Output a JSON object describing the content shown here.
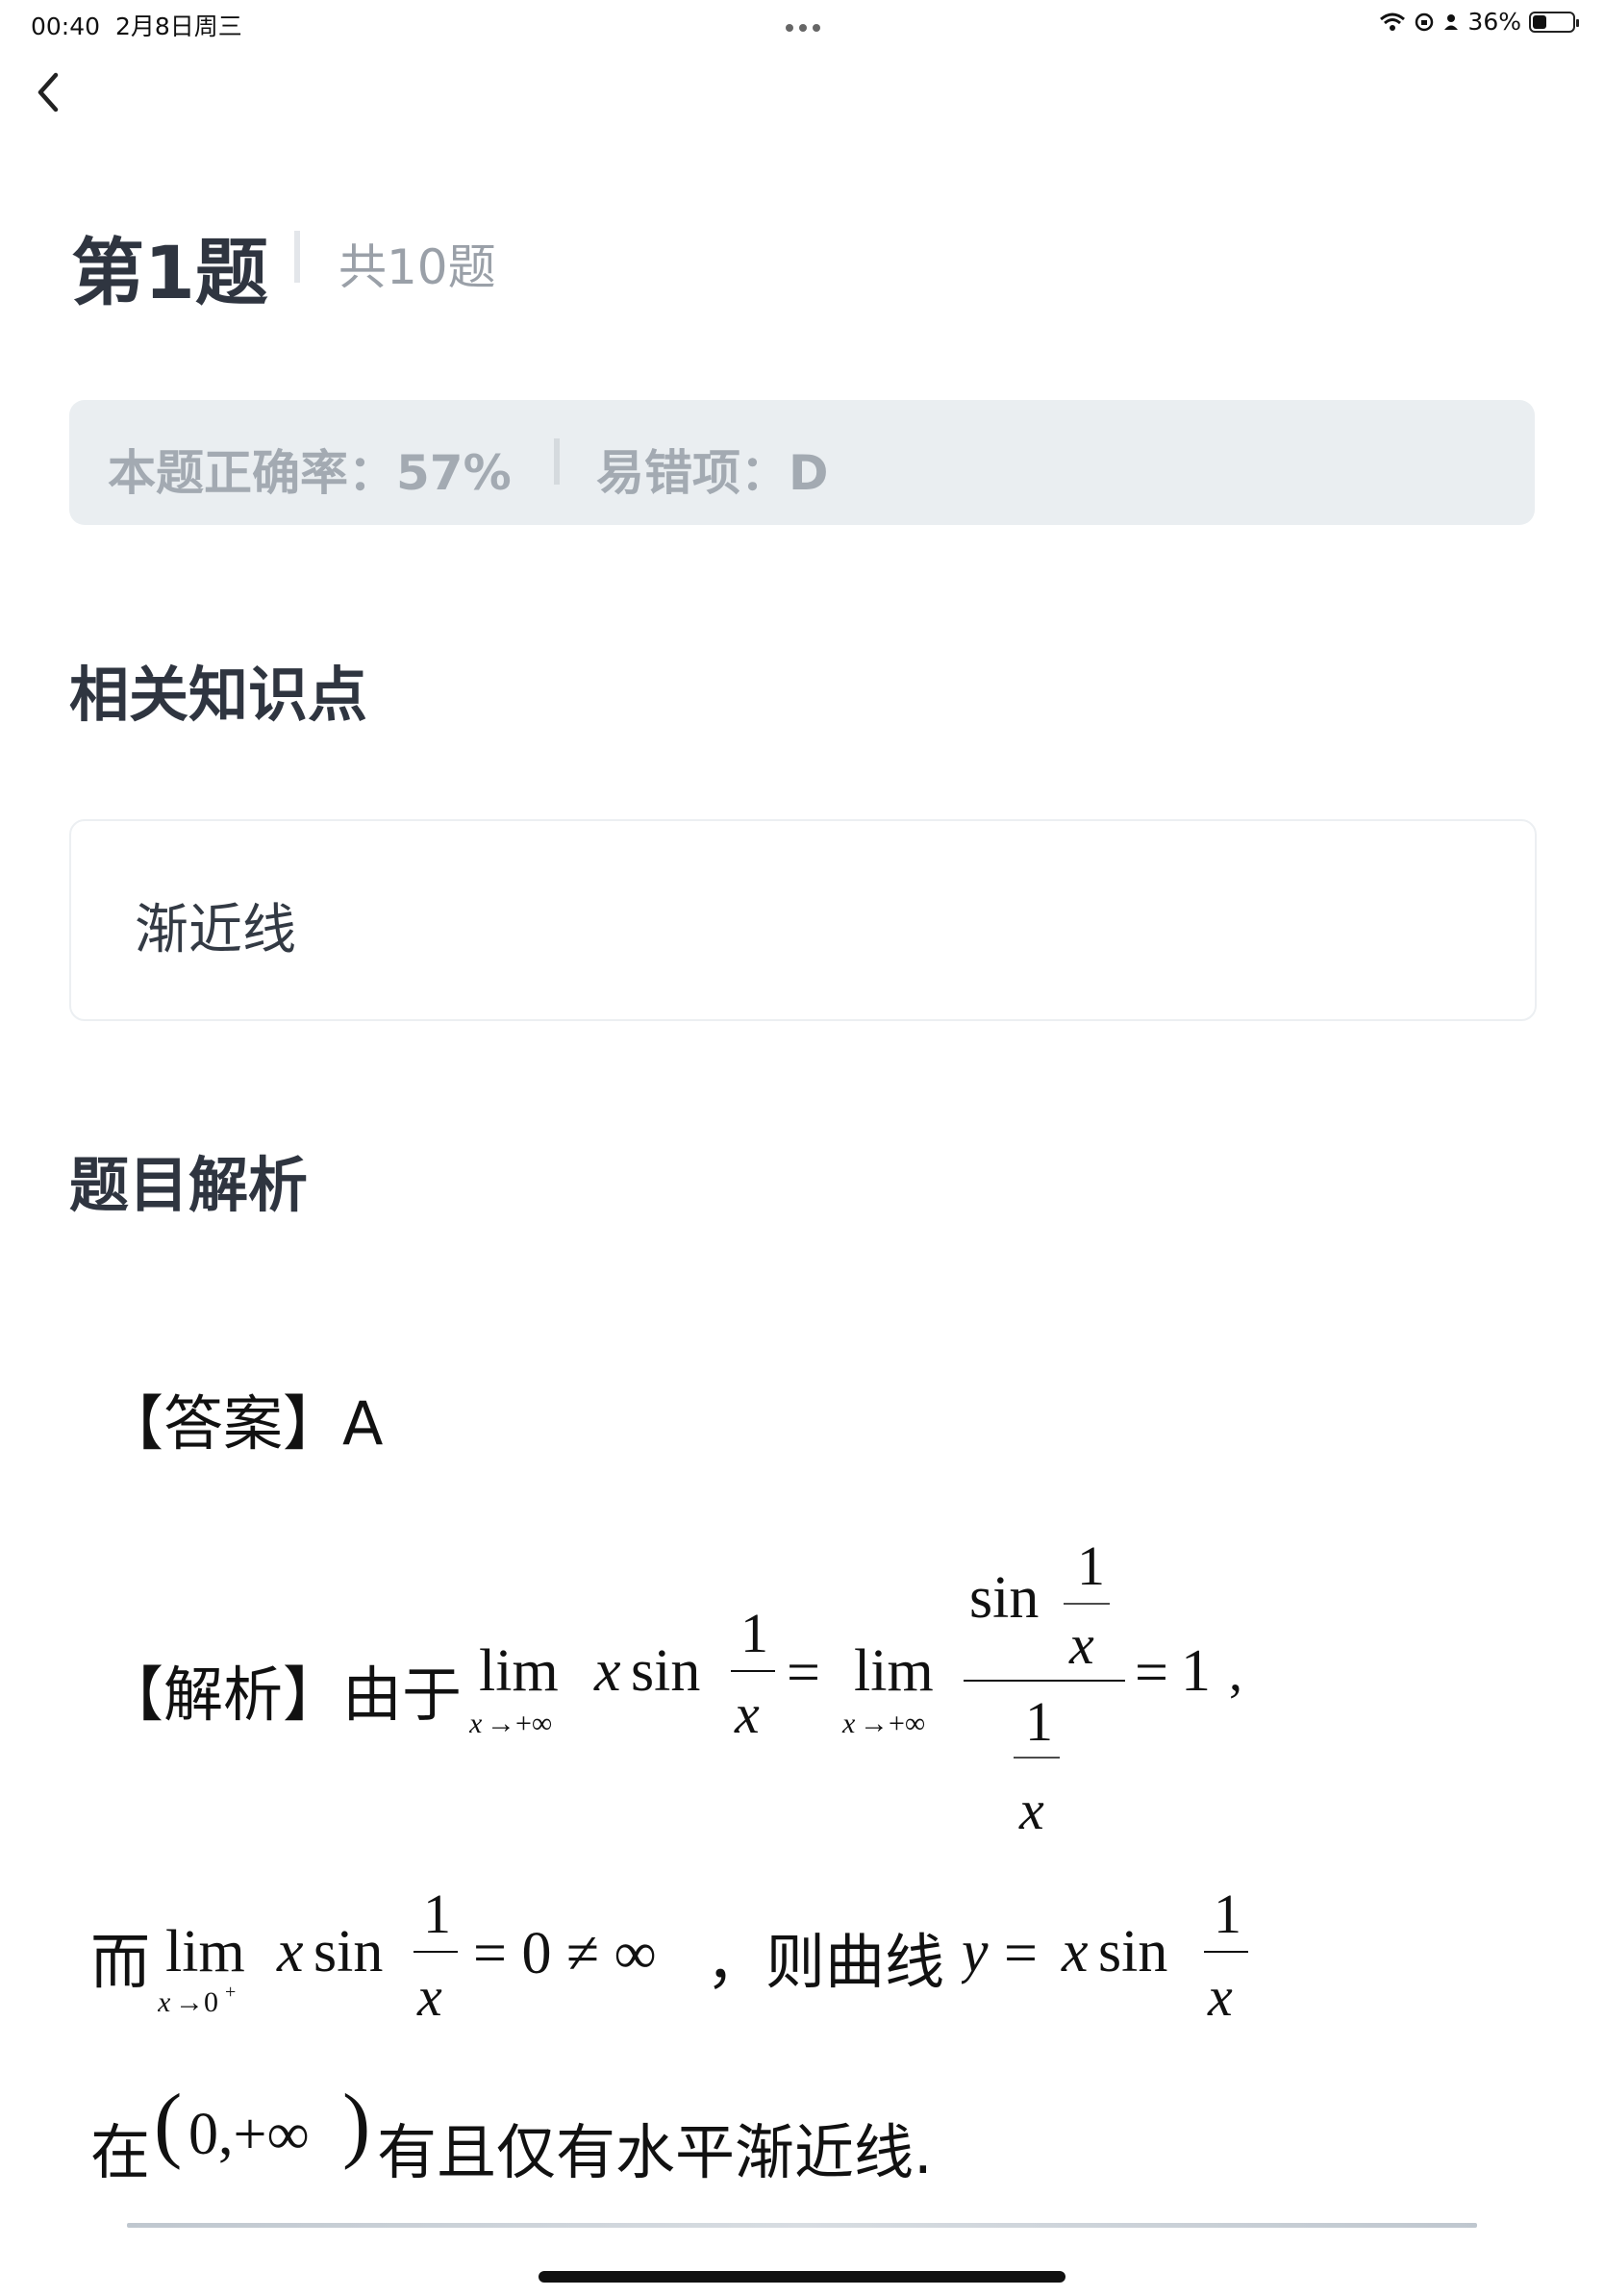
{
  "status_bar": {
    "time": "00:40",
    "date": "2月8日周三",
    "battery": "36%",
    "battery_level": 0.36
  },
  "header": {
    "question_label": "第1题",
    "total_label": "共10题"
  },
  "stats": {
    "accuracy_label": "本题正确率：57%",
    "wrong_option_label": "易错项：D"
  },
  "knowledge": {
    "title": "相关知识点",
    "item": "渐近线"
  },
  "analysis": {
    "title": "题目解析",
    "answer_label": "【答案】A",
    "explanation_label": "【解析】由于",
    "line2_prefix": "而",
    "line2_middle": "，则曲线",
    "line3_prefix": "在",
    "line3_suffix": "有且仅有水平渐近线."
  }
}
